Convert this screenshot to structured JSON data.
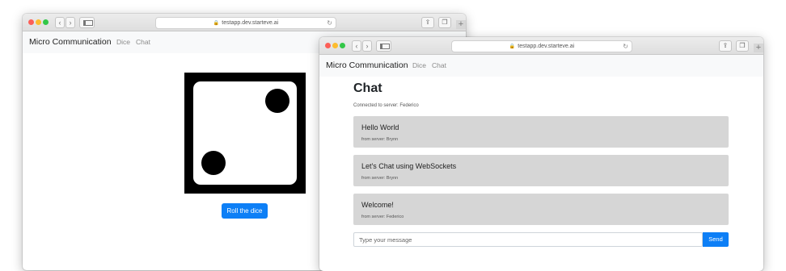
{
  "window1": {
    "url": "testapp.dev.starteve.ai",
    "brand": "Micro Communication",
    "nav": [
      "Dice",
      "Chat"
    ],
    "roll_label": "Roll the dice",
    "dice_value": 2
  },
  "window2": {
    "url": "testapp.dev.starteve.ai",
    "brand": "Micro Communication",
    "nav": [
      "Dice",
      "Chat"
    ],
    "heading": "Chat",
    "status": "Connected to server: Federico",
    "messages": [
      {
        "text": "Hello World",
        "from": "from server: Brynn"
      },
      {
        "text": "Let's Chat using WebSockets",
        "from": "from server: Brynn"
      },
      {
        "text": "Welcome!",
        "from": "from server: Federico"
      }
    ],
    "input_placeholder": "Type your message",
    "send_label": "Send"
  },
  "colors": {
    "primary": "#0d7ff6",
    "message_bg": "#d6d6d6"
  },
  "icons": [
    "back-icon",
    "forward-icon",
    "sidebar-icon",
    "lock-icon",
    "reload-icon",
    "share-icon",
    "tabs-icon",
    "new-tab-icon"
  ]
}
